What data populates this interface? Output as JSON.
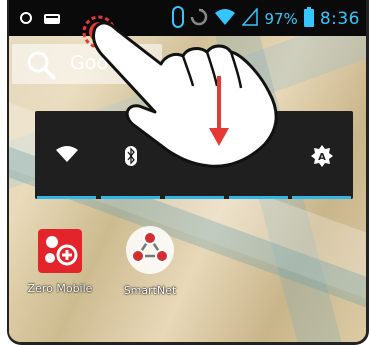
{
  "status_bar": {
    "battery_percent": "97%",
    "time": "8:36",
    "icons": [
      "notification-circle-icon",
      "message-icon",
      "sync-icon",
      "alarm-icon",
      "wifi-icon",
      "signal-icon",
      "battery-icon"
    ]
  },
  "search": {
    "visible_text": "Goo",
    "icon": "search-icon"
  },
  "quick_settings": {
    "tiles": [
      {
        "icon": "wifi-icon"
      },
      {
        "icon": "bluetooth-icon"
      },
      {
        "icon": "mobile-data-icon"
      },
      {
        "icon": "hidden-tile-icon"
      },
      {
        "icon": "auto-brightness-icon",
        "glyph": "A"
      }
    ],
    "accent_color": "#33b5e5"
  },
  "apps": [
    {
      "label": "Zero Mobile",
      "icon": "zero-mobile-icon",
      "color": "#e3242b"
    },
    {
      "label": "SmartNet",
      "icon": "smartnet-icon",
      "color": "#d32f2f"
    }
  ],
  "gesture": {
    "type": "swipe-down",
    "arrow_color": "#e53935",
    "touch_point_color": "#e53935"
  }
}
